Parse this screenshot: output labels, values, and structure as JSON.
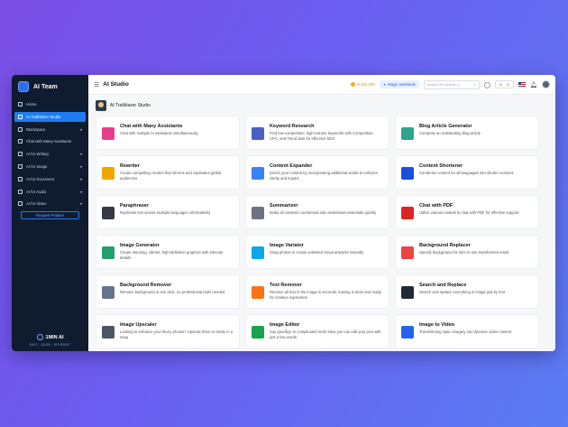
{
  "sidebar": {
    "brand": "AI Team",
    "items": [
      {
        "label": "Home",
        "icon": "home-icon",
        "active": false,
        "chevron": false
      },
      {
        "label": "AI Trailblazer Studio",
        "icon": "studio-icon",
        "active": true,
        "chevron": false
      },
      {
        "label": "Workspace",
        "icon": "workspace-icon",
        "active": false,
        "chevron": true
      },
      {
        "label": "Chat with Many Assistants",
        "icon": "chat-icon",
        "active": false,
        "chevron": false
      },
      {
        "label": "AI for Writing",
        "icon": "pen-icon",
        "active": false,
        "chevron": true
      },
      {
        "label": "AI for Image",
        "icon": "image-icon",
        "active": false,
        "chevron": true
      },
      {
        "label": "AI for Document",
        "icon": "document-icon",
        "active": false,
        "chevron": true
      },
      {
        "label": "AI for Audio",
        "icon": "audio-icon",
        "active": false,
        "chevron": true
      },
      {
        "label": "AI for Video",
        "icon": "video-icon",
        "active": false,
        "chevron": true
      }
    ],
    "request_label": "Request Feature",
    "footer_brand": "1MIN AI",
    "footer_tagline": "EASY - QUICK - EFFICIENT"
  },
  "header": {
    "title": "AI Studio",
    "credits": "8,192,290",
    "magic_label": "Magic Notebook",
    "search_placeholder": "Search AI content, p...",
    "toggle_a": "A",
    "toggle_b": "G"
  },
  "main": {
    "section_title": "AI Trailblazer Studio",
    "cards": [
      {
        "title": "Chat with Many Assistants",
        "desc": "Chat with multiple AI assistants simultaneously",
        "icon": "multi-chat-icon",
        "color": "#e83e8c"
      },
      {
        "title": "Keyword Research",
        "desc": "Find low-competition, high-volume keywords with Competition, CPC, and Trend data for effective SEO",
        "icon": "keyword-icon",
        "color": "#4a5fc1"
      },
      {
        "title": "Blog Article Generator",
        "desc": "Compose an outstanding blog article",
        "icon": "blog-icon",
        "color": "#2ca58d"
      },
      {
        "title": "Rewriter",
        "desc": "Create compelling content that informs and captivates global audiences",
        "icon": "rewrite-icon",
        "color": "#f0a500"
      },
      {
        "title": "Content Expander",
        "desc": "Enrich your content by incorporating additional words to enhance clarity and impact",
        "icon": "expand-icon",
        "color": "#3b82f6"
      },
      {
        "title": "Content Shortener",
        "desc": "Condense content for all languages into shorter versions",
        "icon": "shorten-icon",
        "color": "#1d4ed8"
      },
      {
        "title": "Paraphraser",
        "desc": "Rephrase text across multiple languages informatively",
        "icon": "paraphrase-icon",
        "color": "#333a44"
      },
      {
        "title": "Summarizer",
        "desc": "Make all contents condensed and understand essentials quickly",
        "icon": "summary-icon",
        "color": "#6b7280"
      },
      {
        "title": "Chat with PDF",
        "desc": "Utilize various models to chat with PDF for effective support",
        "icon": "pdf-icon",
        "color": "#dc2626"
      },
      {
        "title": "Image Generator",
        "desc": "Create stunning, vibrant, high-definition graphics with intricate details",
        "icon": "image-gen-icon",
        "color": "#22a06b"
      },
      {
        "title": "Image Variator",
        "desc": "Snap photos to create unlimited visual artworks instantly",
        "icon": "image-variator-icon",
        "color": "#0ea5e9"
      },
      {
        "title": "Background Replacer",
        "desc": "Specify background for item to see transformed result",
        "icon": "bg-replace-icon",
        "color": "#ef4444"
      },
      {
        "title": "Background Remover",
        "desc": "Remove background in one click, no professional tools needed",
        "icon": "bg-remove-icon",
        "color": "#64748b"
      },
      {
        "title": "Text Remover",
        "desc": "Remove all text in the image in seconds, leaving it clean and ready for creative expression",
        "icon": "text-remove-icon",
        "color": "#f97316"
      },
      {
        "title": "Search and Replace",
        "desc": "Search and replace everything in image just by text",
        "icon": "search-replace-icon",
        "color": "#1f2937"
      },
      {
        "title": "Image Upscaler",
        "desc": "Looking to enhance your blurry photos? Upscale them to clarity in a snap",
        "icon": "upscale-icon",
        "color": "#4b5563"
      },
      {
        "title": "Image Editor",
        "desc": "Say goodbye to complicated tools! Now you can edit your pics with just a few words",
        "icon": "image-edit-icon",
        "color": "#16a34a"
      },
      {
        "title": "Image to Video",
        "desc": "Transforming static imagery into dynamic video content",
        "icon": "image-video-icon",
        "color": "#2563eb"
      }
    ]
  }
}
